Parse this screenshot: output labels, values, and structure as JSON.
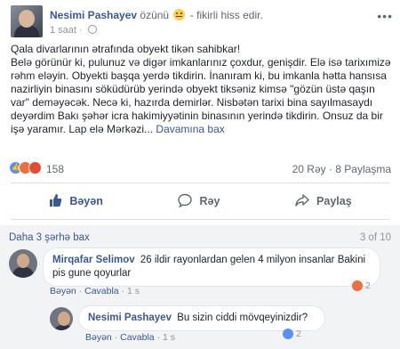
{
  "post": {
    "author": "Nesimi Pashayev",
    "feeling_prefix": "özünü",
    "feeling_suffix": "- fikirli hiss edir.",
    "time": "1 saat",
    "more_icon": "more-horizontal-icon",
    "lines": [
      "Qala divarlarının ətrafında obyekt tikən sahibkar!",
      "Belə görünür ki, pulunuz və digər imkanlarınız çoxdur, genişdir. Elə isə tarixımizə rəhm eləyin. Obyekti başqa yerdə tikdirin. İnanıram ki, bu imkanla hətta hansısa nazirliyin binasını söküdürüb yerində obyekt tiksəniz kimsə \"gözün üstə qaşın var\" deməyəcək. Necə ki, hazırda demirlər. Nisbətən tarixi bina sayılmasaydı deyərdim Bakı şəhər icra hakimiyyətinin binasının yerində tikdirin. Onsuz da bir işə yaramır. Lap elə Mərkəzi..."
    ],
    "continue_label": "Davamına bax"
  },
  "reactions": {
    "count": "158",
    "comments_shares": "20 Rəy · 8 Paylaşma"
  },
  "actions": {
    "like": "Bəyən",
    "comment": "Rəy",
    "share": "Paylaş"
  },
  "comments_section": {
    "more_label": "Daha 3 şərhə bax",
    "count_label": "3 of 10",
    "items": [
      {
        "author": "Mirqafar Selimov",
        "text": "26 ildir rayonlardan gelen 4 milyon insanlar Bakini pis gune qoyurlar",
        "like": "Bəyən",
        "reply": "Cavabla",
        "time": "1 s",
        "reaction_count": "2"
      },
      {
        "author": "Nesimi Pashayev",
        "text": "Bu sizin ciddi mövqeyinizdir?",
        "like": "Bəyən",
        "reply": "Cavabla",
        "time": "1 s",
        "reaction_count": "2"
      }
    ]
  },
  "colors": {
    "link": "#385898",
    "like_blue": "#5890ff",
    "angry": "#f26d3d"
  }
}
